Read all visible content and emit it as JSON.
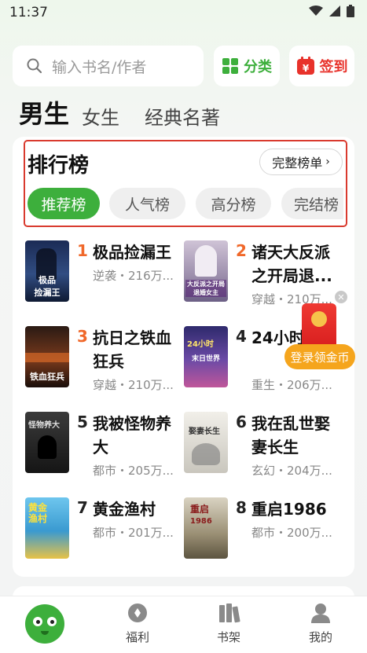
{
  "status_bar": {
    "time": "11:37"
  },
  "search": {
    "placeholder": "输入书名/作者"
  },
  "header_buttons": {
    "category": "分类",
    "checkin": "签到"
  },
  "gender_tabs": [
    "男生",
    "女生",
    "经典名著"
  ],
  "ranking": {
    "title": "排行榜",
    "full_list": "完整榜单",
    "chips": [
      "推荐榜",
      "人气榜",
      "高分榜",
      "完结榜"
    ]
  },
  "books": [
    {
      "rank": "1",
      "title": "极品捡漏王",
      "meta": "逆袭・216万..."
    },
    {
      "rank": "2",
      "title": "诸天大反派之开局退...",
      "meta": "穿越・210万..."
    },
    {
      "rank": "3",
      "title": "抗日之铁血狂兵",
      "meta": "穿越・210万..."
    },
    {
      "rank": "4",
      "title": "24小时世界",
      "meta": "重生・206万..."
    },
    {
      "rank": "5",
      "title": "我被怪物养大",
      "meta": "都市・205万..."
    },
    {
      "rank": "6",
      "title": "我在乱世娶妻长生",
      "meta": "玄幻・204万..."
    },
    {
      "rank": "7",
      "title": "黄金渔村",
      "meta": "都市・201万..."
    },
    {
      "rank": "8",
      "title": "重启1986",
      "meta": "都市・200万..."
    }
  ],
  "floating": {
    "label": "登录领金币"
  },
  "bottom_nav": [
    "福利",
    "书架",
    "我的"
  ],
  "colors": {
    "accent": "#3daf3c",
    "rank_hot": "#f0682a",
    "outline": "#d93a2e",
    "coin": "#f5a51d"
  }
}
